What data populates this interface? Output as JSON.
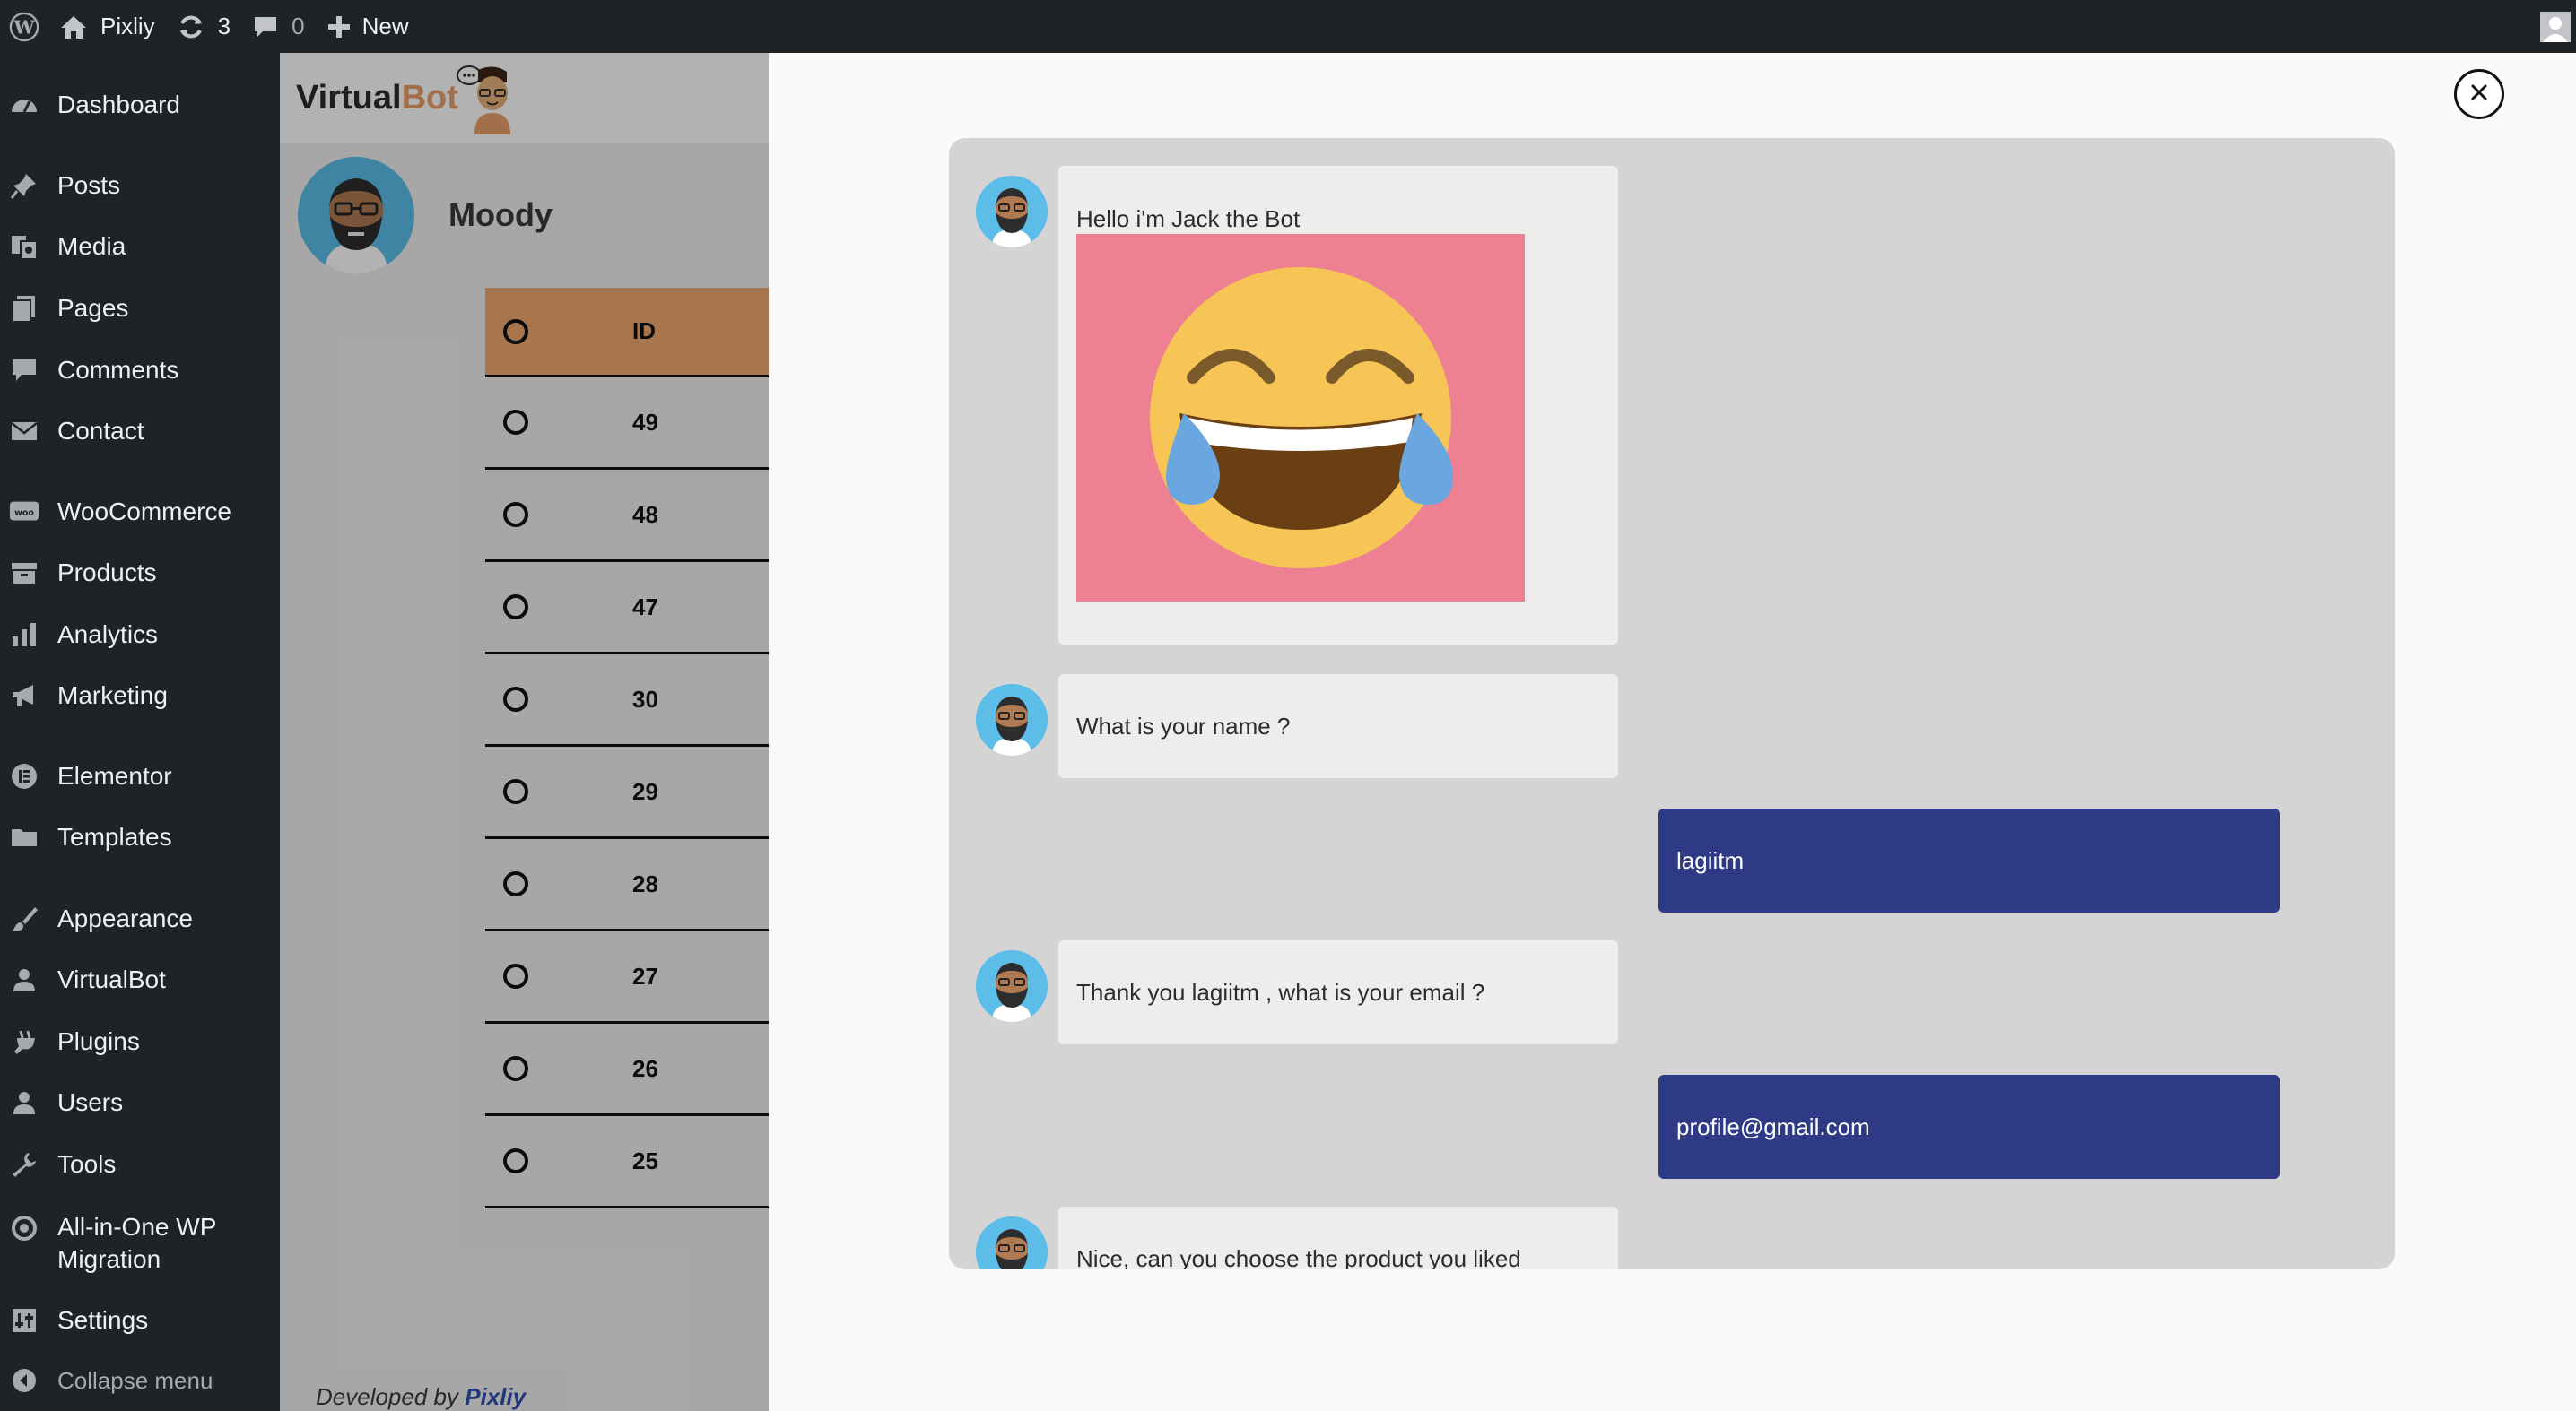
{
  "adminbar": {
    "site_name": "Pixliy",
    "updates_count": "3",
    "comments_count": "0",
    "new_label": "New"
  },
  "sidebar": {
    "items": [
      {
        "label": "Dashboard",
        "icon": "dashboard-icon"
      },
      {
        "label": "Posts",
        "icon": "pin-icon"
      },
      {
        "label": "Media",
        "icon": "media-icon"
      },
      {
        "label": "Pages",
        "icon": "pages-icon"
      },
      {
        "label": "Comments",
        "icon": "comment-icon"
      },
      {
        "label": "Contact",
        "icon": "mail-icon"
      },
      {
        "label": "WooCommerce",
        "icon": "woo-icon"
      },
      {
        "label": "Products",
        "icon": "archive-icon"
      },
      {
        "label": "Analytics",
        "icon": "bar-chart-icon"
      },
      {
        "label": "Marketing",
        "icon": "megaphone-icon"
      },
      {
        "label": "Elementor",
        "icon": "elementor-icon"
      },
      {
        "label": "Templates",
        "icon": "folder-icon"
      },
      {
        "label": "Appearance",
        "icon": "brush-icon"
      },
      {
        "label": "VirtualBot",
        "icon": "user-icon"
      },
      {
        "label": "Plugins",
        "icon": "plugin-icon"
      },
      {
        "label": "Users",
        "icon": "users-icon"
      },
      {
        "label": "Tools",
        "icon": "wrench-icon"
      },
      {
        "label": "All-in-One WP",
        "label2": "Migration",
        "icon": "migration-icon"
      },
      {
        "label": "Settings",
        "icon": "settings-icon"
      }
    ],
    "collapse_label": "Collapse menu"
  },
  "plugin": {
    "logo_part1": "Virtual",
    "logo_part2": "Bot",
    "bot_name": "Moody",
    "table_header": "ID",
    "ids": [
      "49",
      "48",
      "47",
      "30",
      "29",
      "28",
      "27",
      "26",
      "25"
    ],
    "developed_by": "Developed by",
    "developer": "Pixliy"
  },
  "chat": {
    "messages": [
      {
        "from": "bot",
        "text": "Hello i'm Jack the Bot"
      },
      {
        "from": "bot",
        "text": "What is your name ?"
      },
      {
        "from": "user",
        "text": "lagiitm"
      },
      {
        "from": "bot",
        "text": "Thank you lagiitm , what is your email ?"
      },
      {
        "from": "user",
        "text": "profile@gmail.com"
      },
      {
        "from": "bot",
        "text": "Nice, can you choose the product you liked"
      }
    ]
  },
  "colors": {
    "admin_bg": "#1d2327",
    "table_header_bg": "#f0a870",
    "user_bubble": "#2f3a87",
    "bot_bubble": "#efecec",
    "avatar_bg": "#5bbde8",
    "emoji_bg": "#ee8191"
  }
}
